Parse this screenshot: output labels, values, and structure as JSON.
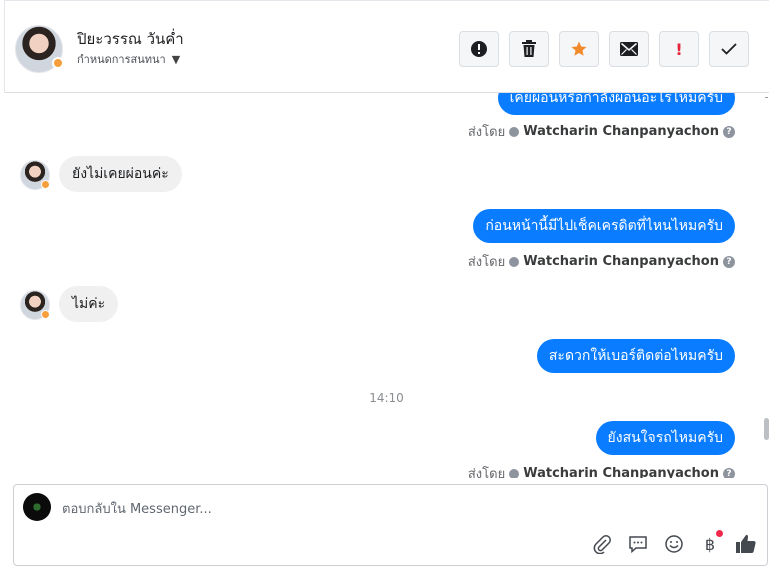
{
  "header": {
    "contact_name": "ปิยะวรรณ วันค่ำ",
    "assign_label": "กำหนดการสนทนา"
  },
  "actions": [
    {
      "name": "spam-button",
      "icon": "alert-circle-icon"
    },
    {
      "name": "delete-button",
      "icon": "trash-icon"
    },
    {
      "name": "star-button",
      "icon": "star-icon"
    },
    {
      "name": "mark-unread-button",
      "icon": "envelope-icon"
    },
    {
      "name": "follow-up-button",
      "icon": "exclamation-icon"
    },
    {
      "name": "mark-done-button",
      "icon": "checkmark-icon"
    }
  ],
  "messages": {
    "out1": "เคยผ่อนหรือกำลังผ่อนอะไรไหมครับ",
    "in1": "ยังไม่เคยผ่อนค่ะ",
    "out2": "ก่อนหน้านี้มีไปเช็คเครดิตที่ไหนไหมครับ",
    "in2": "ไม่ค่ะ",
    "out3": "สะดวกให้เบอร์ติดต่อไหมครับ",
    "time_sep": "14:10",
    "out4": "ยังสนใจรถไหมครับ"
  },
  "sent_by": {
    "prefix": "ส่งโดย",
    "agent": "Watcharin Chanpanyachon",
    "help": "?"
  },
  "composer": {
    "placeholder": "ตอบกลับใน Messenger..."
  },
  "colors": {
    "outgoing_bubble": "#0a7cff",
    "incoming_bubble": "#f0f0f0",
    "star": "#f2892a",
    "follow_up": "#e4253b",
    "notification_badge": "#f02849"
  }
}
